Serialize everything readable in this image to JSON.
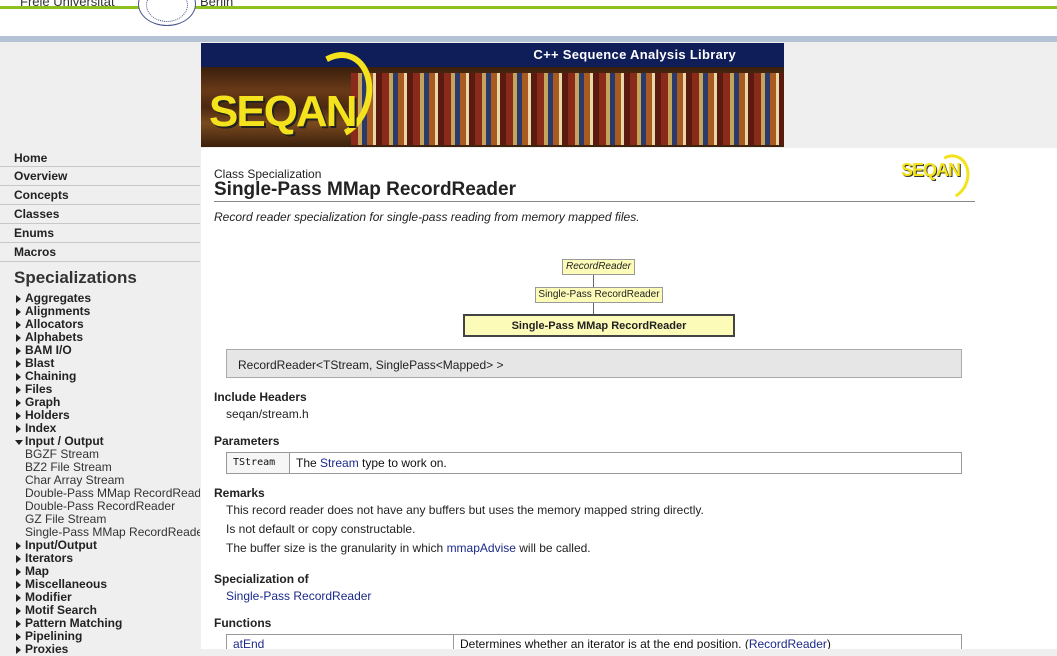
{
  "header": {
    "university_text": "Freie Universität",
    "university_city": "Berlin",
    "slogan": "C++ Sequence Analysis Library",
    "logo_text": "SEQAN"
  },
  "sidebar": {
    "top_links": [
      "Home",
      "Overview",
      "Concepts",
      "Classes",
      "Enums",
      "Macros"
    ],
    "section_title": "Specializations",
    "categories_before": [
      "Aggregates",
      "Alignments",
      "Allocators",
      "Alphabets",
      "BAM I/O",
      "Blast",
      "Chaining",
      "Files",
      "Graph",
      "Holders",
      "Index"
    ],
    "open_category": "Input / Output",
    "open_items": [
      "BGZF Stream",
      "BZ2 File Stream",
      "Char Array Stream",
      "Double-Pass MMap RecordReader",
      "Double-Pass RecordReader",
      "GZ File Stream",
      "Single-Pass MMap RecordReader"
    ],
    "categories_after": [
      "Input/Output",
      "Iterators",
      "Map",
      "Miscellaneous",
      "Modifier",
      "Motif Search",
      "Pattern Matching",
      "Pipelining",
      "Proxies"
    ]
  },
  "main": {
    "kind": "Class Specialization",
    "title": "Single-Pass MMap RecordReader",
    "logo_text": "SEQAN",
    "description": "Record reader specialization for single-pass reading from memory mapped files.",
    "hierarchy": [
      "RecordReader",
      "Single-Pass RecordReader",
      "Single-Pass MMap RecordReader"
    ],
    "signature": "RecordReader<TStream, SinglePass<Mapped> >",
    "include_heading": "Include Headers",
    "include_file": "seqan/stream.h",
    "params_heading": "Parameters",
    "param_name": "TStream",
    "param_desc_pre": "The ",
    "param_link": "Stream",
    "param_desc_post": " type to work on.",
    "remarks_heading": "Remarks",
    "remark_1": "This record reader does not have any buffers but uses the memory mapped string directly.",
    "remark_2": "Is not default or copy constructable.",
    "remark_3_pre": "The buffer size is the granularity in which ",
    "remark_3_link": "mmapAdvise",
    "remark_3_post": " will be called.",
    "spec_heading": "Specialization of",
    "spec_link": "Single-Pass RecordReader",
    "functions_heading": "Functions",
    "func_name": "atEnd",
    "func_desc_pre": "Determines whether an iterator is at the end position. (",
    "func_desc_link": "RecordReader",
    "func_desc_post": ")"
  }
}
